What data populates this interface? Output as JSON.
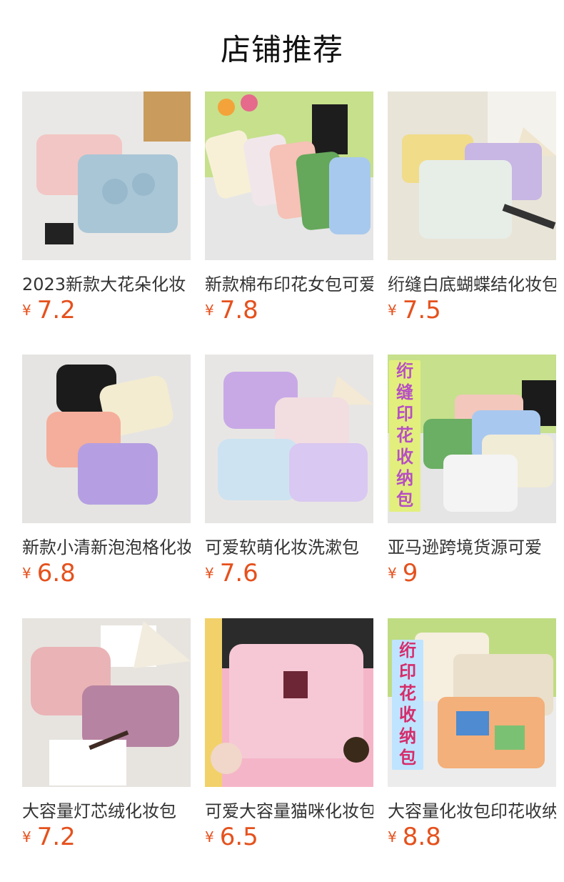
{
  "header": {
    "title": "店铺推荐"
  },
  "currency_symbol": "¥",
  "products": [
    {
      "name": "2023新款大花朵化妆",
      "price": "7.2",
      "image": "pink-blue-flower-quilted-bags"
    },
    {
      "name": "新款棉布印花女包可爱",
      "price": "7.8",
      "image": "floral-cotton-pouches"
    },
    {
      "name": "绗缝白底蝴蝶结化妆包",
      "price": "7.5",
      "image": "quilted-bow-bags"
    },
    {
      "name": "新款小清新泡泡格化妆",
      "price": "6.8",
      "image": "bubble-grid-bags"
    },
    {
      "name": "可爱软萌化妆洗漱包",
      "price": "7.6",
      "image": "tie-dye-bubble-bags"
    },
    {
      "name": "亚马逊跨境货源可爱",
      "price": "9",
      "image": "quilted-floral-storage-bags",
      "stamp": "绗缝印花收纳包"
    },
    {
      "name": "大容量灯芯绒化妆包",
      "price": "7.2",
      "image": "corduroy-makeup-bags"
    },
    {
      "name": "可爱大容量猫咪化妆包",
      "price": "6.5",
      "image": "cat-quilted-bag"
    },
    {
      "name": "大容量化妆包印花收纳",
      "price": "8.8",
      "image": "patchwork-print-bags",
      "stamp": "绗印花收纳包"
    }
  ]
}
